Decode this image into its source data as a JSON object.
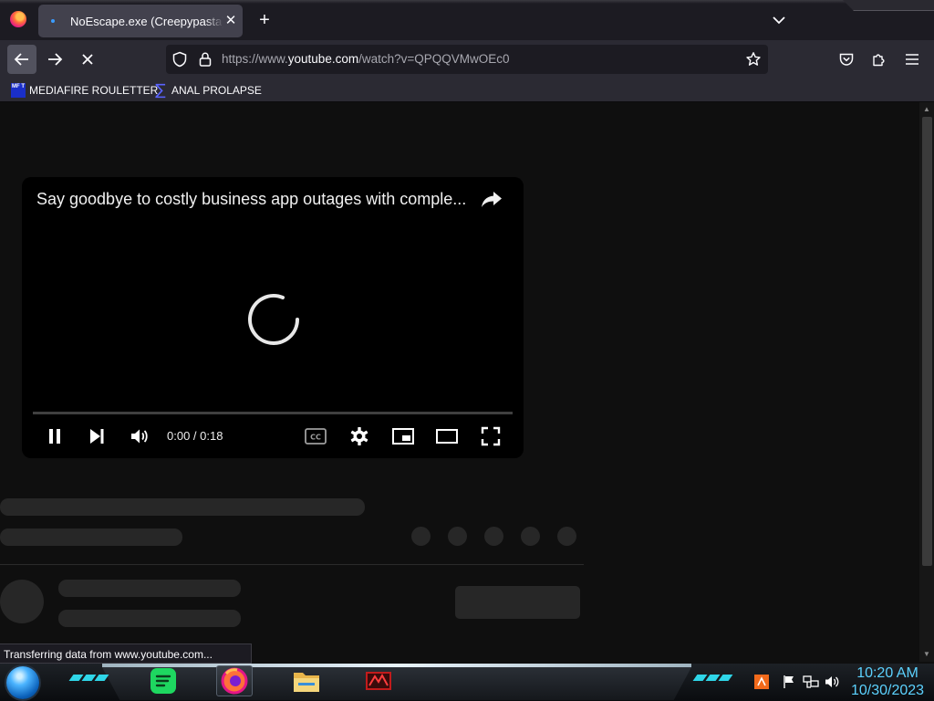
{
  "browser": {
    "tab": {
      "title": "NoEscape.exe (Creepypasta) - YouTube",
      "close_glyph": "✕"
    },
    "new_tab_glyph": "+",
    "url": {
      "prefix": "https://www.",
      "host": "youtube.com",
      "path": "/watch?v=QPQQVMwOEc0"
    },
    "bookmarks": [
      {
        "label": "MEDIAFIRE ROULETTER",
        "icon": "mft-favicon",
        "icon_text": "MF T"
      },
      {
        "label": "ANAL PROLAPSE",
        "icon": "sigma-favicon",
        "icon_text": "∑"
      }
    ],
    "status_text": "Transferring data from www.youtube.com..."
  },
  "player": {
    "title": "Say goodbye to costly business app outages with comple...",
    "time": "0:00 / 0:18",
    "progress_fraction": 0,
    "state": "loading"
  },
  "taskbar": {
    "apps": [
      {
        "name": "spotify",
        "icon": "spotify-icon",
        "active": false
      },
      {
        "name": "firefox",
        "icon": "firefox-icon",
        "active": true
      },
      {
        "name": "file-explorer",
        "icon": "folder-icon",
        "active": false
      },
      {
        "name": "game",
        "icon": "game-icon",
        "active": false
      }
    ],
    "clock": {
      "time": "10:20 AM",
      "date": "10/30/2023"
    }
  },
  "colors": {
    "accent_cyan": "#2fd6e8",
    "clock": "#5cd2ff",
    "youtube_bg": "#0f0f0f",
    "skeleton": "#272727",
    "urlbar": "#1c1b22"
  }
}
